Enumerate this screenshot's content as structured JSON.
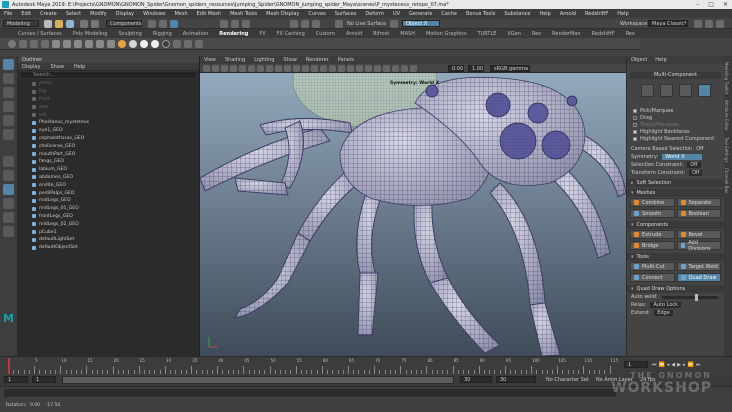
{
  "titlebar": {
    "title": "Autodesk Maya 2019: E:\\Projects\\GNOMON\\GNOMON_Spider\\Gnomon_spiders_resources\\Jumping_Spider\\GNOMON_jumping_spider_Maya\\scenes\\P_mysteceus_retopo_07.ma*"
  },
  "menubar": {
    "items": [
      "File",
      "Edit",
      "Create",
      "Select",
      "Modify",
      "Display",
      "Windows",
      "Mesh",
      "Edit Mesh",
      "Mesh Tools",
      "Mesh Display",
      "Curves",
      "Surfaces",
      "Deform",
      "UV",
      "Generate",
      "Cache",
      "Bonus Tools",
      "Substance",
      "Help",
      "Arnold",
      "RedshiftF",
      "Help"
    ]
  },
  "statusline": {
    "mode": "Modeling",
    "components": "Components",
    "live_surface": "No Live Surface",
    "symmetry_field": "Object X",
    "workspace_label": "Workspace :",
    "workspace_value": "Maya Classic*"
  },
  "shelf": {
    "tabs": [
      "Curves / Surfaces",
      "Poly Modeling",
      "Sculpting",
      "Rigging",
      "Animation",
      "Rendering",
      "FX",
      "FX Caching",
      "Custom",
      "Arnold",
      "Bifrost",
      "MASH",
      "Motion Graphics",
      "TURTLE",
      "XGen",
      "Rex",
      "RenderMan",
      "RedshiftF",
      "Rex"
    ],
    "active_tab": "Rendering"
  },
  "outliner": {
    "title": "Outliner",
    "menu": [
      "Display",
      "Show",
      "Help"
    ],
    "search_placeholder": "Search...",
    "items": [
      {
        "label": "persp",
        "dim": true
      },
      {
        "label": "top",
        "dim": true
      },
      {
        "label": "front",
        "dim": true
      },
      {
        "label": "side",
        "dim": true
      },
      {
        "label": "left",
        "dim": true
      },
      {
        "label": "Pholdaeus_mysteteus",
        "dim": false
      },
      {
        "label": "eye1_GEO",
        "dim": false
      },
      {
        "label": "cephalothorax_GEO",
        "dim": false
      },
      {
        "label": "chelicerae_GEO",
        "dim": false
      },
      {
        "label": "mouthPart_GEO",
        "dim": false
      },
      {
        "label": "fangs_GEO",
        "dim": false
      },
      {
        "label": "labium_GEO",
        "dim": false
      },
      {
        "label": "abdomen_GEO",
        "dim": false
      },
      {
        "label": "endite_GEO",
        "dim": false
      },
      {
        "label": "pedilPalps_GEO",
        "dim": false
      },
      {
        "label": "midLegs_GEO",
        "dim": false
      },
      {
        "label": "midLegs_01_GEO",
        "dim": false
      },
      {
        "label": "frontLegs_GEO",
        "dim": false
      },
      {
        "label": "midLegs_02_GEO",
        "dim": false
      },
      {
        "label": "pCube1",
        "dim": false
      },
      {
        "label": "defaultLightSet",
        "dim": false
      },
      {
        "label": "defaultObjectSet",
        "dim": false
      }
    ]
  },
  "viewport": {
    "menu": [
      "View",
      "Shading",
      "Lighting",
      "Show",
      "Renderer",
      "Panels"
    ],
    "exposure": "0.00",
    "gamma": "1.00",
    "color_space": "sRGB gamma",
    "symmetry_label": "Symmetry: World X"
  },
  "modeling_toolkit": {
    "menu": [
      "Object",
      "Help"
    ],
    "title": "Multi-Component",
    "options": [
      {
        "label": "Pick/Marquee",
        "checked": true
      },
      {
        "label": "Drag",
        "checked": false
      },
      {
        "label": "Tweak/Marquee",
        "checked": false
      },
      {
        "label": "Highlight Backfaces",
        "checked": true
      },
      {
        "label": "Highlight Nearest Component",
        "checked": true
      }
    ],
    "camera_based_selection": "Camera Based Selection",
    "camera_based_value": "Off",
    "symmetry_label": "Symmetry:",
    "symmetry_value": "World X",
    "selection_constraint_label": "Selection Constraint:",
    "selection_constraint_value": "Off",
    "transform_constraint_label": "Transform Constraint:",
    "transform_constraint_value": "Off",
    "soft_selection": "Soft Selection",
    "sections": {
      "meshes": {
        "title": "Meshes",
        "buttons": [
          "Combine",
          "Separate",
          "Smooth",
          "Boolean"
        ]
      },
      "components": {
        "title": "Components",
        "buttons": [
          "Extrude",
          "Bevel",
          "Bridge",
          "Add Divisions"
        ]
      },
      "tools": {
        "title": "Tools",
        "buttons": [
          "Multi-Cut",
          "Target Weld",
          "Connect",
          "Quad Draw"
        ],
        "active": "Quad Draw"
      }
    },
    "quad_draw_options": "Quad Draw Options",
    "auto_weld_label": "Auto weld:",
    "relax_label": "Relax:",
    "relax_value": "Auto Lock",
    "extend_label": "Extend:",
    "extend_value": "Edge"
  },
  "side_tabs": [
    "Modeling Toolkit",
    "Attribute Editor",
    "Tool Settings",
    "Channel Box"
  ],
  "timeslider": {
    "ticks": [
      "5",
      "10",
      "15",
      "20",
      "25",
      "30",
      "35",
      "40",
      "45",
      "50",
      "55",
      "60",
      "65",
      "70",
      "75",
      "80",
      "85",
      "90",
      "95",
      "100",
      "105",
      "110",
      "115"
    ],
    "current_frame": "1"
  },
  "rangeslider": {
    "start": "1",
    "playback_start": "1",
    "playback_end": "30",
    "end": "30",
    "range_display": "30",
    "character_set": "No Character Set",
    "anim_layer": "No Anim Layer",
    "fps": "24 fps"
  },
  "cmdline": {
    "rotation_label": "Rotation:",
    "rotation_values": "0.00    -17.50"
  },
  "watermark": {
    "line1": "THE GNOMON",
    "line2": "WORKSHOP"
  },
  "colors": {
    "accent": "#5285a6",
    "orange": "#e58a2c",
    "viewport_top": "#93a9bd",
    "viewport_bottom": "#3f4c59"
  }
}
